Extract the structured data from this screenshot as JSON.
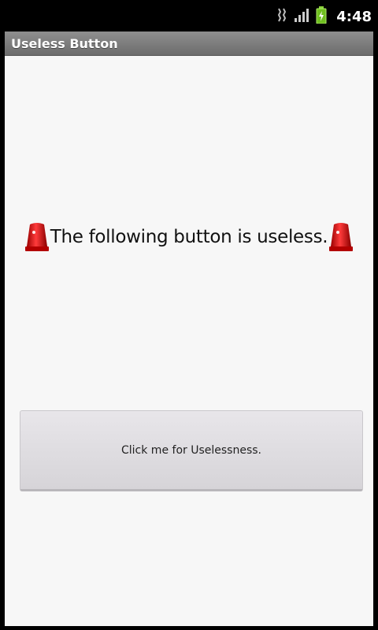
{
  "status_bar": {
    "time": "4:48",
    "icons": [
      "usb-debug-icon",
      "signal-icon",
      "battery-charging-icon"
    ]
  },
  "app": {
    "title": "Useless Button"
  },
  "main": {
    "message": "The following button is useless.",
    "message_icon": "siren-icon",
    "button_label": "Click me for Uselessness."
  }
}
